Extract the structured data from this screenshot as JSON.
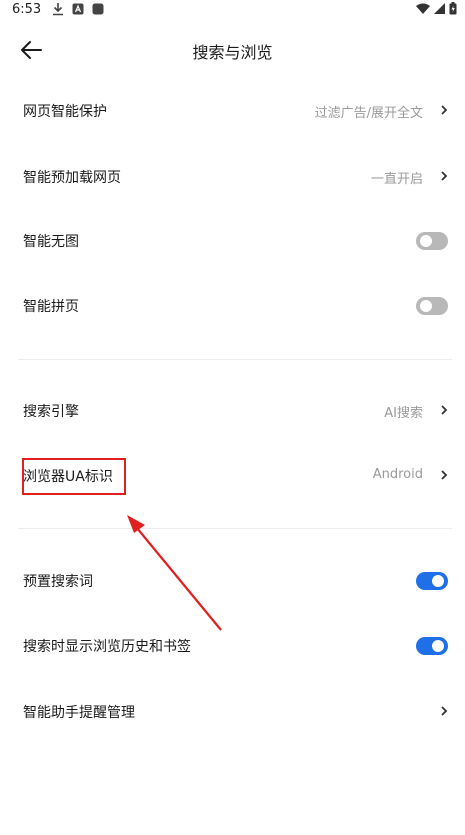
{
  "status": {
    "time": "6:53"
  },
  "header": {
    "title": "搜索与浏览"
  },
  "rows": [
    {
      "label": "网页智能保护",
      "value": "过滤广告/展开全文"
    },
    {
      "label": "智能预加载网页",
      "value": "一直开启"
    },
    {
      "label": "智能无图",
      "toggle": "off"
    },
    {
      "label": "智能拼页",
      "toggle": "off"
    },
    {
      "label": "搜索引擎",
      "value": "AI搜索"
    },
    {
      "label": "浏览器UA标识",
      "value": "Android"
    },
    {
      "label": "预置搜索词",
      "toggle": "on"
    },
    {
      "label": "搜索时显示浏览历史和书签",
      "toggle": "on"
    },
    {
      "label": "智能助手提醒管理"
    }
  ],
  "colors": {
    "accent": "#1e6fe8",
    "annotation": "#e02020"
  },
  "icons": [
    "download-icon",
    "a-badge-icon",
    "square-icon",
    "wifi-icon",
    "signal-icon",
    "battery-icon",
    "back-arrow-icon",
    "chevron-right-icon"
  ]
}
